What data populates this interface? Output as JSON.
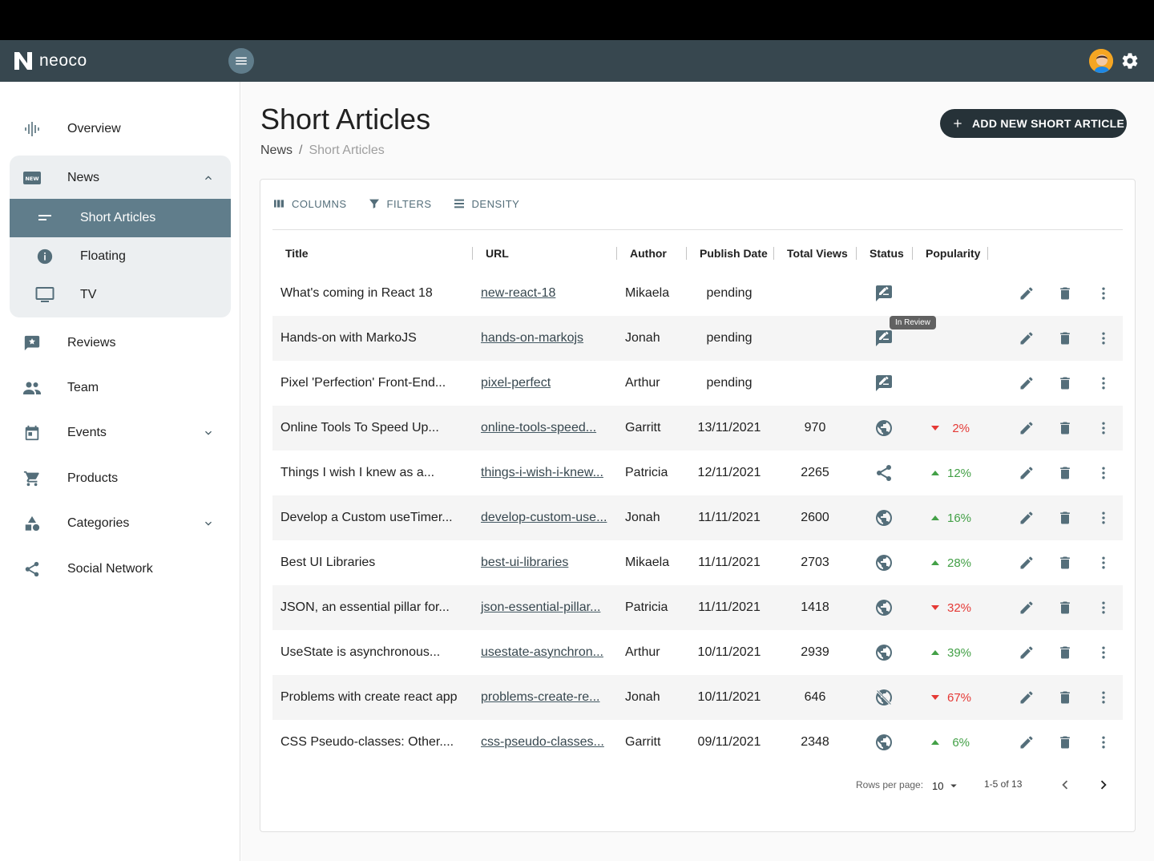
{
  "app": {
    "name": "neoco"
  },
  "colors": {
    "appbar": "#37474f",
    "accent": "#607d8b",
    "up": "#43a047",
    "down": "#e53935",
    "primary_button": "#263238"
  },
  "sidebar": {
    "items": [
      {
        "label": "Overview",
        "icon": "waveform-icon"
      },
      {
        "label": "News",
        "icon": "news-icon",
        "expanded": true,
        "children": [
          {
            "label": "Short Articles",
            "icon": "short-text-icon",
            "active": true
          },
          {
            "label": "Floating",
            "icon": "info-icon"
          },
          {
            "label": "TV",
            "icon": "tv-icon"
          }
        ]
      },
      {
        "label": "Reviews",
        "icon": "rate-review-icon"
      },
      {
        "label": "Team",
        "icon": "people-icon"
      },
      {
        "label": "Events",
        "icon": "calendar-icon",
        "expandable": true
      },
      {
        "label": "Products",
        "icon": "cart-icon"
      },
      {
        "label": "Categories",
        "icon": "category-icon",
        "expandable": true
      },
      {
        "label": "Social Network",
        "icon": "share-icon"
      }
    ]
  },
  "page": {
    "title": "Short Articles",
    "breadcrumb": {
      "parent": "News",
      "separator": "/",
      "current": "Short Articles"
    },
    "add_button": "ADD NEW SHORT ARTICLE"
  },
  "toolbar": {
    "columns": "COLUMNS",
    "filters": "FILTERS",
    "density": "DENSITY"
  },
  "table": {
    "headers": {
      "title": "Title",
      "url": "URL",
      "author": "Author",
      "date": "Publish Date",
      "views": "Total Views",
      "status": "Status",
      "popularity": "Popularity"
    },
    "rows": [
      {
        "title": "What's coming in React 18",
        "url": "new-react-18",
        "author": "Mikaela",
        "date": "pending",
        "views": "",
        "status": "in-review-icon",
        "trend": "",
        "pop": ""
      },
      {
        "title": "Hands-on with MarkoJS",
        "url": "hands-on-markojs",
        "author": "Jonah",
        "date": "pending",
        "views": "",
        "status": "in-review-icon",
        "trend": "",
        "pop": ""
      },
      {
        "title": "Pixel 'Perfection' Front-End...",
        "url": "pixel-perfect",
        "author": "Arthur",
        "date": "pending",
        "views": "",
        "status": "in-review-icon",
        "trend": "",
        "pop": ""
      },
      {
        "title": "Online Tools To Speed Up...",
        "url": "online-tools-speed...",
        "author": "Garritt",
        "date": "13/11/2021",
        "views": "970",
        "status": "public-icon",
        "trend": "down",
        "pop": "2%"
      },
      {
        "title": "Things I wish I knew as a...",
        "url": "things-i-wish-i-knew...",
        "author": "Patricia",
        "date": "12/11/2021",
        "views": "2265",
        "status": "share-icon",
        "trend": "up",
        "pop": "12%"
      },
      {
        "title": "Develop a Custom useTimer...",
        "url": "develop-custom-use...",
        "author": "Jonah",
        "date": "11/11/2021",
        "views": "2600",
        "status": "public-icon",
        "trend": "up",
        "pop": "16%"
      },
      {
        "title": "Best UI Libraries",
        "url": "best-ui-libraries",
        "author": "Mikaela",
        "date": "11/11/2021",
        "views": "2703",
        "status": "public-icon",
        "trend": "up",
        "pop": "28%"
      },
      {
        "title": "JSON, an essential pillar for...",
        "url": "json-essential-pillar...",
        "author": "Patricia",
        "date": "11/11/2021",
        "views": "1418",
        "status": "public-icon",
        "trend": "down",
        "pop": "32%"
      },
      {
        "title": "UseState is asynchronous...",
        "url": "usestate-asynchron...",
        "author": "Arthur",
        "date": "10/11/2021",
        "views": "2939",
        "status": "public-icon",
        "trend": "up",
        "pop": "39%"
      },
      {
        "title": "Problems with create react app",
        "url": "problems-create-re...",
        "author": "Jonah",
        "date": "10/11/2021",
        "views": "646",
        "status": "public-off-icon",
        "trend": "down",
        "pop": "67%"
      },
      {
        "title": "CSS Pseudo-classes: Other....",
        "url": "css-pseudo-classes...",
        "author": "Garritt",
        "date": "09/11/2021",
        "views": "2348",
        "status": "public-icon",
        "trend": "up",
        "pop": "6%"
      }
    ]
  },
  "tooltip": "In Review",
  "pagination": {
    "rows_per_page_label": "Rows per page:",
    "rows_per_page": "10",
    "range": "1-5 of 13"
  }
}
